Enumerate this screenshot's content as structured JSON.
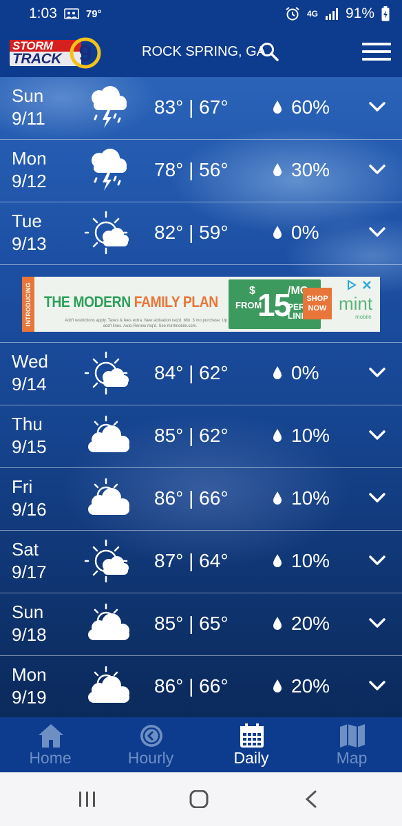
{
  "status_bar": {
    "time": "1:03",
    "temp": "79°",
    "network": "4G",
    "battery": "91%"
  },
  "header": {
    "logo_top": "STORM",
    "logo_bottom": "TRACK",
    "logo_number": "9",
    "location": "ROCK SPRING, GA"
  },
  "forecast": [
    {
      "day": "Sun",
      "date": "9/11",
      "temps": "83° | 67°",
      "precip": "60%",
      "icon": "thunderstorm-icon"
    },
    {
      "day": "Mon",
      "date": "9/12",
      "temps": "78° | 56°",
      "precip": "30%",
      "icon": "thunderstorm-icon"
    },
    {
      "day": "Tue",
      "date": "9/13",
      "temps": "82° | 59°",
      "precip": "0%",
      "icon": "partly-sunny-icon"
    },
    {
      "day": "Wed",
      "date": "9/14",
      "temps": "84° | 62°",
      "precip": "0%",
      "icon": "partly-sunny-icon"
    },
    {
      "day": "Thu",
      "date": "9/15",
      "temps": "85° | 62°",
      "precip": "10%",
      "icon": "mostly-cloudy-icon"
    },
    {
      "day": "Fri",
      "date": "9/16",
      "temps": "86° | 66°",
      "precip": "10%",
      "icon": "mostly-cloudy-icon"
    },
    {
      "day": "Sat",
      "date": "9/17",
      "temps": "87° | 64°",
      "precip": "10%",
      "icon": "partly-sunny-icon"
    },
    {
      "day": "Sun",
      "date": "9/18",
      "temps": "85° | 65°",
      "precip": "20%",
      "icon": "mostly-cloudy-icon"
    },
    {
      "day": "Mon",
      "date": "9/19",
      "temps": "86° | 66°",
      "precip": "20%",
      "icon": "mostly-cloudy-icon"
    }
  ],
  "ad": {
    "side_label": "INTRODUCING",
    "headline_1": "THE MODERN ",
    "headline_2": "FAMILY PLAN",
    "fine_print": "Add'l restrictions apply. Taxes & fees extra. New activation req'd. Min. 3 mo purchase. Up to 4 add'l lines. Auto-Renew req'd. See mintmobile.com.",
    "from": "FROM",
    "dollar": "$",
    "price": "15",
    "per_mo": "/MO",
    "per_line": "PER LINE",
    "cta": "SHOP NOW",
    "brand": "mint",
    "brand_sub": "mobile"
  },
  "bottom_nav": [
    {
      "label": "Home",
      "icon": "home-icon",
      "active": false
    },
    {
      "label": "Hourly",
      "icon": "clock-icon",
      "active": false
    },
    {
      "label": "Daily",
      "icon": "calendar-icon",
      "active": true
    },
    {
      "label": "Map",
      "icon": "map-icon",
      "active": false
    }
  ],
  "colors": {
    "header_bg": "#0d3b8e",
    "nav_inactive": "#6d8fc4",
    "nav_active": "#ffffff"
  }
}
